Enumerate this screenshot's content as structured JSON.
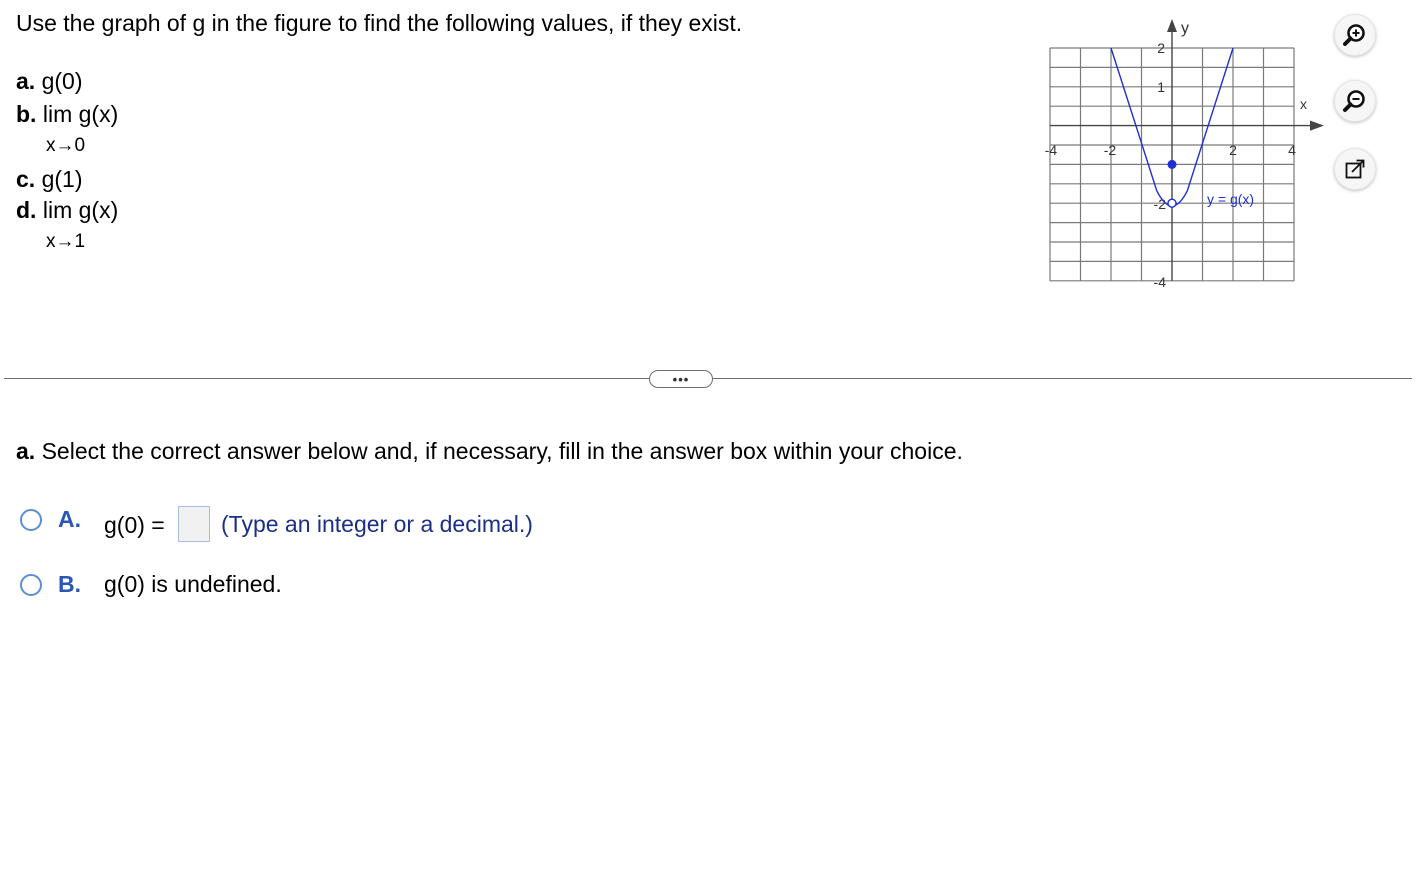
{
  "question": {
    "title": "Use the graph of g in the figure to find the following values, if they exist.",
    "parts": [
      {
        "letter": "a.",
        "text": "g(0)"
      },
      {
        "letter": "b.",
        "text": "lim  g(x)",
        "sub": "x→0"
      },
      {
        "letter": "c.",
        "text": "g(1)"
      },
      {
        "letter": "d.",
        "text": "lim  g(x)",
        "sub": "x→1"
      }
    ]
  },
  "graph": {
    "axis_x_label": "x",
    "axis_y_label": "y",
    "x_ticks": [
      "-4",
      "-2",
      "2",
      "4"
    ],
    "y_ticks": [
      "2",
      "1",
      "-2",
      "-4"
    ],
    "curve_label": "y = g(x)",
    "curve_color": "#1f2fd6",
    "filled_point": {
      "x": 0,
      "y": -1
    },
    "open_point": {
      "x": 0,
      "y": -2
    }
  },
  "toolbar": {
    "zoom_in_icon": "zoom-in-icon",
    "zoom_out_icon": "zoom-out-icon",
    "popout_icon": "popout-icon"
  },
  "divider": {
    "more_label": "•••"
  },
  "answer": {
    "instruction_bold": "a.",
    "instruction": "Select the correct answer below and, if necessary, fill in the answer box within your choice.",
    "options": [
      {
        "letter": "A.",
        "text": "g(0) =",
        "hint": "(Type an integer or a decimal.)"
      },
      {
        "letter": "B.",
        "text": "g(0) is undefined."
      }
    ]
  },
  "colors": {
    "accent_blue": "#2c55b8",
    "hint_navy": "#1c2f86",
    "radio_border": "#5b8ed6"
  }
}
